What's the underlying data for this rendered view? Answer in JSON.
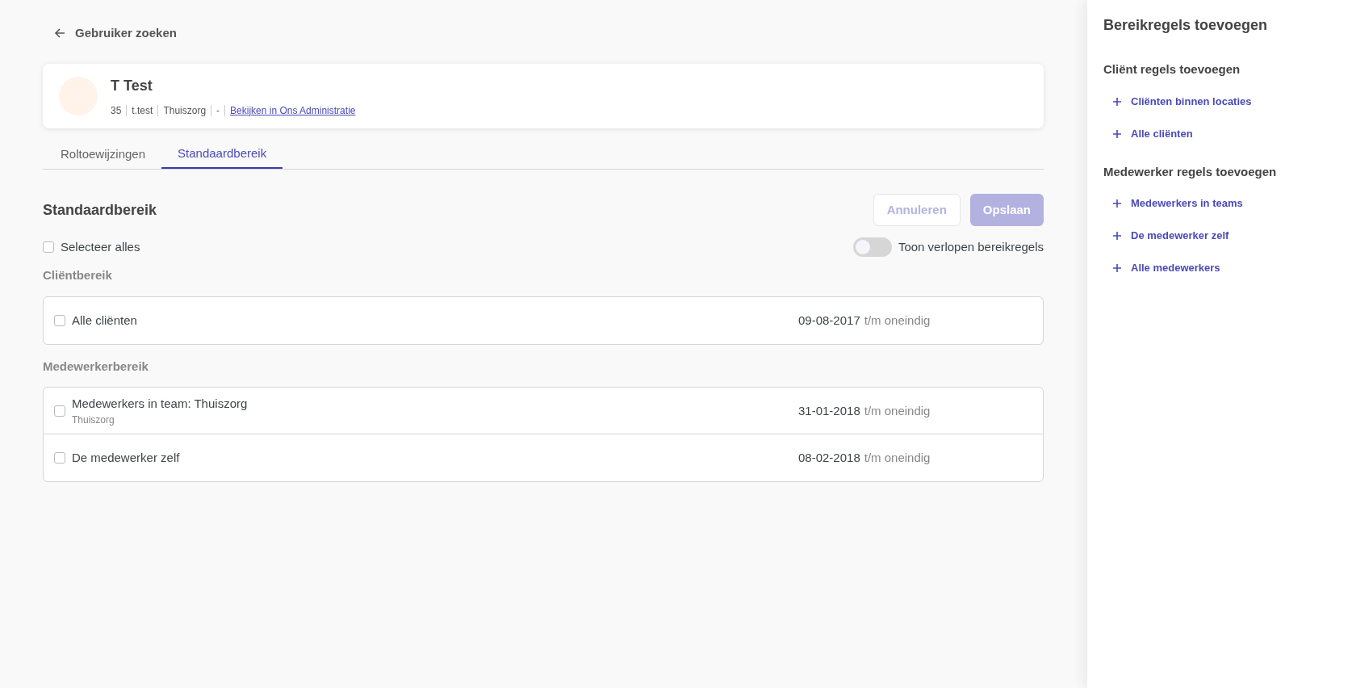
{
  "back_link": {
    "label": "Gebruiker zoeken"
  },
  "user": {
    "name": "T Test",
    "meta": [
      "35",
      "t.test",
      "Thuiszorg",
      "-"
    ],
    "link": "Bekijken in Ons Administratie"
  },
  "tabs": [
    {
      "label": "Roltoewijzingen",
      "selected": false
    },
    {
      "label": "Standaardbereik",
      "selected": true
    }
  ],
  "section": {
    "title": "Standaardbereik",
    "buttons": [
      {
        "label": "Annuleren",
        "kind": "secondary",
        "disabled": true
      },
      {
        "label": "Opslaan",
        "kind": "primary",
        "disabled": true
      }
    ]
  },
  "select_all": {
    "label": "Selecteer alles",
    "checked": false
  },
  "toggle": {
    "label": "Toon verlopen bereikregels",
    "on": false
  },
  "groups": [
    {
      "title": "Cliëntbereik",
      "rows": [
        {
          "label": "Alle cliënten",
          "checked": false,
          "start": "09-08-2017",
          "end": "t/m oneindig"
        }
      ]
    },
    {
      "title": "Medewerkerbereik",
      "rows": [
        {
          "label": "Medewerkers in team: Thuiszorg",
          "sublabel": "Thuiszorg",
          "checked": false,
          "start": "31-01-2018",
          "end": "t/m oneindig"
        },
        {
          "label": "De medewerker zelf",
          "checked": false,
          "start": "08-02-2018",
          "end": "t/m oneindig"
        }
      ]
    }
  ],
  "sidebar": {
    "title": "Bereikregels toevoegen",
    "sections": [
      {
        "title": "Cliënt regels toevoegen",
        "items": [
          "Cliënten binnen locaties",
          "Alle cliënten"
        ]
      },
      {
        "title": "Medewerker regels toevoegen",
        "items": [
          "Medewerkers in teams",
          "De medewerker zelf",
          "Alle medewerkers"
        ]
      }
    ]
  }
}
